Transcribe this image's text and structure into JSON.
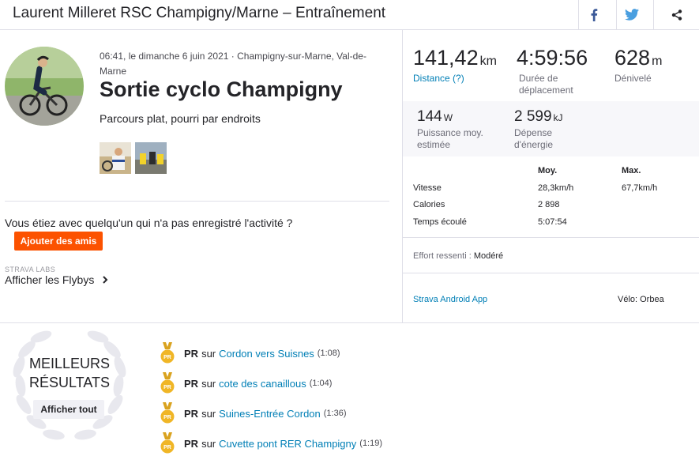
{
  "header": {
    "title": "Laurent Milleret RSC Champigny/Marne – Entraînement",
    "share_icons": [
      "facebook-icon",
      "twitter-icon",
      "share-icon"
    ]
  },
  "activity": {
    "meta": "06:41, le dimanche 6 juin 2021 · Champigny-sur-Marne, Val-de-Marne",
    "name": "Sortie cyclo Champigny",
    "description": "Parcours plat, pourri par endroits",
    "photos": 2
  },
  "friends": {
    "question": "Vous étiez avec quelqu'un qui n'a pas enregistré l'activité ?",
    "add_button": "Ajouter des amis"
  },
  "labs": {
    "label": "STRAVA LABS",
    "flyby": "Afficher les Flybys"
  },
  "stats": {
    "distance": {
      "value": "141,42",
      "unit": "km",
      "label": "Distance (?)"
    },
    "moving_time": {
      "value": "4:59:56",
      "label": "Durée de déplacement"
    },
    "elevation": {
      "value": "628",
      "unit": "m",
      "label": "Dénivelé"
    },
    "power": {
      "value": "144",
      "unit": "W",
      "label": "Puissance moy. estimée"
    },
    "energy": {
      "value": "2 599",
      "unit": "kJ",
      "label": "Dépense d'énergie"
    }
  },
  "table": {
    "col_avg": "Moy.",
    "col_max": "Max.",
    "rows": [
      {
        "label": "Vitesse",
        "avg": "28,3km/h",
        "max": "67,7km/h"
      },
      {
        "label": "Calories",
        "avg": "2 898",
        "max": ""
      },
      {
        "label": "Temps écoulé",
        "avg": "5:07:54",
        "max": ""
      }
    ]
  },
  "effort": {
    "label": "Effort ressenti :",
    "value": "Modéré"
  },
  "device": {
    "app": "Strava Android App",
    "bike": "Vélo: Orbea"
  },
  "best": {
    "title_line1": "MEILLEURS",
    "title_line2": "RÉSULTATS",
    "show_all": "Afficher tout",
    "pr_label": "PR",
    "pr_sur": "sur",
    "medal_text": "PR",
    "items": [
      {
        "segment": "Cordon vers Suisnes",
        "time": "(1:08)"
      },
      {
        "segment": "cote des canaillous",
        "time": "(1:04)"
      },
      {
        "segment": "Suines-Entrée Cordon",
        "time": "(1:36)"
      },
      {
        "segment": "Cuvette pont RER Champigny",
        "time": "(1:19)"
      }
    ]
  },
  "colors": {
    "accent": "#fc5200",
    "link": "#007fb6",
    "medal": "#f0b626"
  }
}
